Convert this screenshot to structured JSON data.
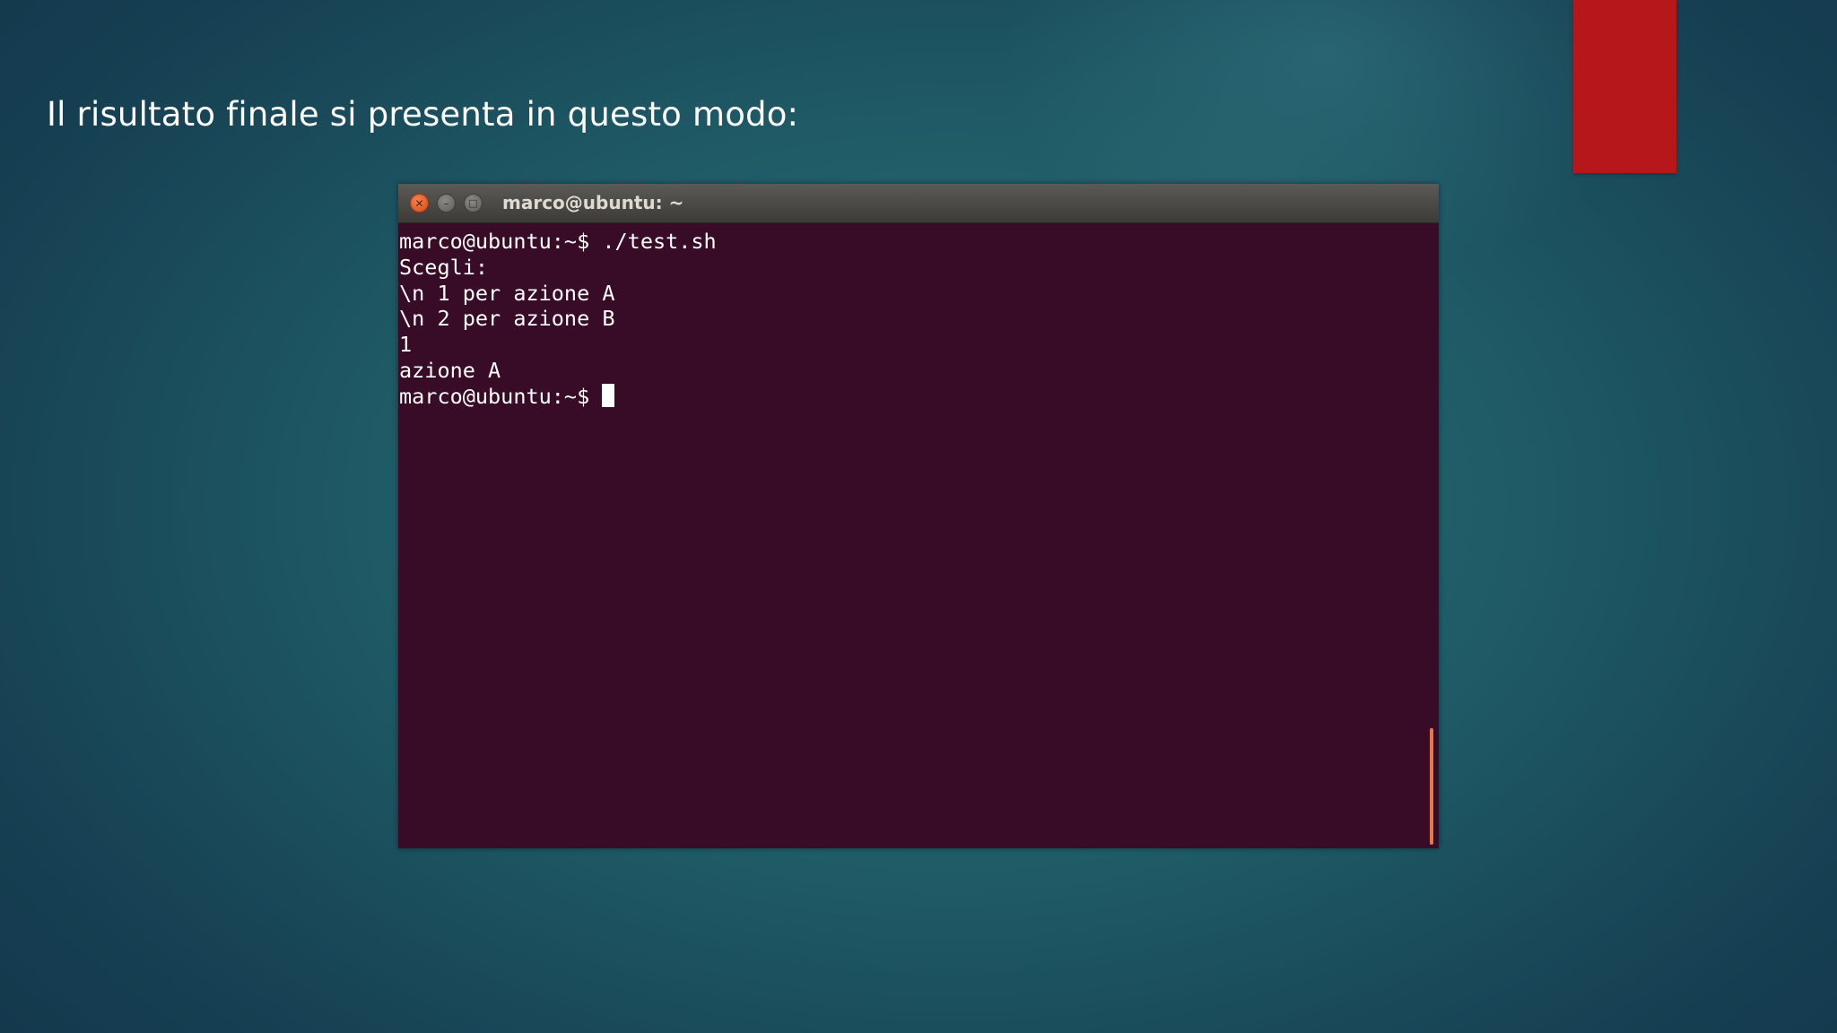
{
  "slide": {
    "title": "Il risultato finale si presenta in questo modo:"
  },
  "colors": {
    "accent_bar": "#b5171b",
    "terminal_background": "#380b27",
    "close_button": "#e3551f",
    "scrollbar": "#e8764a"
  },
  "terminal": {
    "window_title": "marco@ubuntu: ~",
    "buttons": {
      "close_icon": "✕",
      "minimize_icon": "–",
      "maximize_icon": "□"
    },
    "lines": [
      "marco@ubuntu:~$ ./test.sh",
      "Scegli:",
      "\\n 1 per azione A",
      "\\n 2 per azione B",
      "1",
      "azione A"
    ],
    "prompt": "marco@ubuntu:~$ "
  }
}
